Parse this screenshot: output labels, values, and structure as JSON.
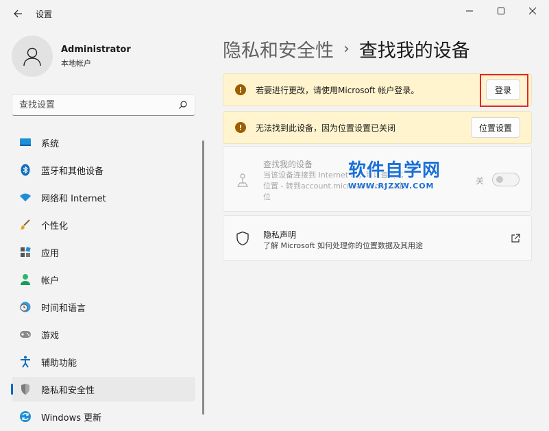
{
  "window": {
    "title": "设置"
  },
  "profile": {
    "name": "Administrator",
    "account_type": "本地帐户"
  },
  "search": {
    "placeholder": "查找设置"
  },
  "sidebar": {
    "items": [
      {
        "label": "系统",
        "icon": "monitor-icon"
      },
      {
        "label": "蓝牙和其他设备",
        "icon": "bluetooth-icon"
      },
      {
        "label": "网络和 Internet",
        "icon": "wifi-icon"
      },
      {
        "label": "个性化",
        "icon": "brush-icon"
      },
      {
        "label": "应用",
        "icon": "apps-icon"
      },
      {
        "label": "帐户",
        "icon": "person-icon"
      },
      {
        "label": "时间和语言",
        "icon": "clock-globe-icon"
      },
      {
        "label": "游戏",
        "icon": "gamepad-icon"
      },
      {
        "label": "辅助功能",
        "icon": "accessibility-icon"
      },
      {
        "label": "隐私和安全性",
        "icon": "shield-icon",
        "selected": true
      },
      {
        "label": "Windows 更新",
        "icon": "update-icon"
      }
    ]
  },
  "breadcrumb": {
    "parent": "隐私和安全性",
    "separator": "›",
    "current": "查找我的设备"
  },
  "banners": {
    "signin": {
      "text": "若要进行更改，请使用Microsoft 帐户登录。",
      "button": "登录"
    },
    "location": {
      "text": "无法找到此设备，因为位置设置已关闭",
      "button": "位置设置"
    }
  },
  "find_device": {
    "title": "查找我的设备",
    "description": "当该设备连接到 Internet 时，可以查看其位置 - 转到account.microsoft.com 以定位",
    "toggle_label": "关",
    "toggle_on": false
  },
  "privacy_statement": {
    "title": "隐私声明",
    "description": "了解 Microsoft 如何处理你的位置数据及其用途"
  },
  "watermark": {
    "text": "软件自学网",
    "url": "WWW.RJZXW.COM"
  },
  "colors": {
    "accent": "#0067c0",
    "warning_bg": "#fff4ce",
    "warning_icon": "#9d5d00",
    "highlight": "#e0262a"
  }
}
